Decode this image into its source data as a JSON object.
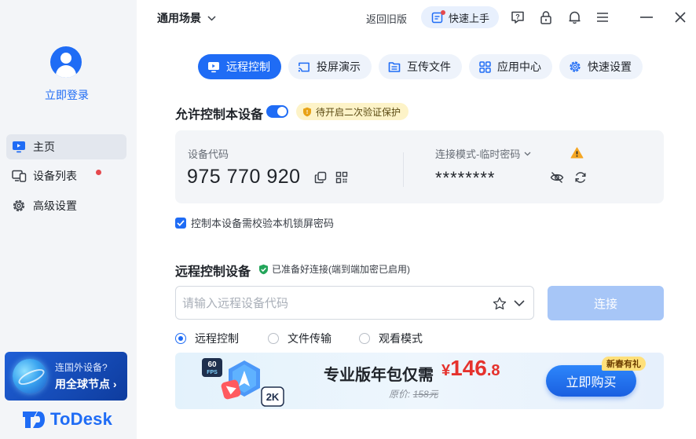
{
  "sidebar": {
    "login_label": "立即登录",
    "nav": [
      {
        "label": "主页",
        "icon": "monitor-icon",
        "active": true
      },
      {
        "label": "设备列表",
        "icon": "devices-icon",
        "has_dot": true
      },
      {
        "label": "高级设置",
        "icon": "gear-icon"
      }
    ],
    "promo": {
      "line1": "连国外设备?",
      "line2": "用全球节点 ›"
    },
    "logo_text": "ToDesk"
  },
  "topbar": {
    "scene_label": "通用场景",
    "back_old_label": "返回旧版",
    "quick_start_label": "快速上手",
    "icons": [
      "help-icon",
      "lock-icon",
      "bell-icon",
      "menu-icon",
      "minimize-icon",
      "close-icon"
    ]
  },
  "tabs": [
    {
      "label": "远程控制",
      "icon": "monitor-icon",
      "active": true
    },
    {
      "label": "投屏演示",
      "icon": "cast-icon"
    },
    {
      "label": "互传文件",
      "icon": "file-transfer-icon"
    },
    {
      "label": "应用中心",
      "icon": "apps-icon"
    },
    {
      "label": "快速设置",
      "icon": "settings-icon"
    }
  ],
  "allow_control": {
    "title": "允许控制本设备",
    "toggle_on": true,
    "badge": "待开启二次验证保护",
    "device_code_label": "设备代码",
    "device_code": "975 770 920",
    "mode_label": "连接模式-临时密码",
    "password_masked": "********",
    "checkbox_label": "控制本设备需校验本机锁屏密码",
    "checkbox_checked": true
  },
  "remote_control": {
    "title": "远程控制设备",
    "ready_text": "已准备好连接(端到端加密已启用)",
    "input_placeholder": "请输入远程设备代码",
    "input_value": "",
    "connect_label": "连接",
    "modes": [
      {
        "label": "远程控制",
        "checked": true
      },
      {
        "label": "文件传输",
        "checked": false
      },
      {
        "label": "观看模式",
        "checked": false
      }
    ]
  },
  "banner": {
    "title": "专业版年包仅需",
    "price_currency": "¥",
    "price_main": "146",
    "price_decimal": ".8",
    "original_label": "原价:",
    "original_price": "158元",
    "buy_label": "立即购买",
    "tag": "新春有礼",
    "badge_fps_num": "60",
    "badge_fps": "FPS",
    "badge_2k": "2K"
  },
  "colors": {
    "accent": "#1f6cf5",
    "sidebar_bg": "#f3f5f8",
    "connect_disabled": "#a7c6f7",
    "price_red": "#e5322d"
  }
}
